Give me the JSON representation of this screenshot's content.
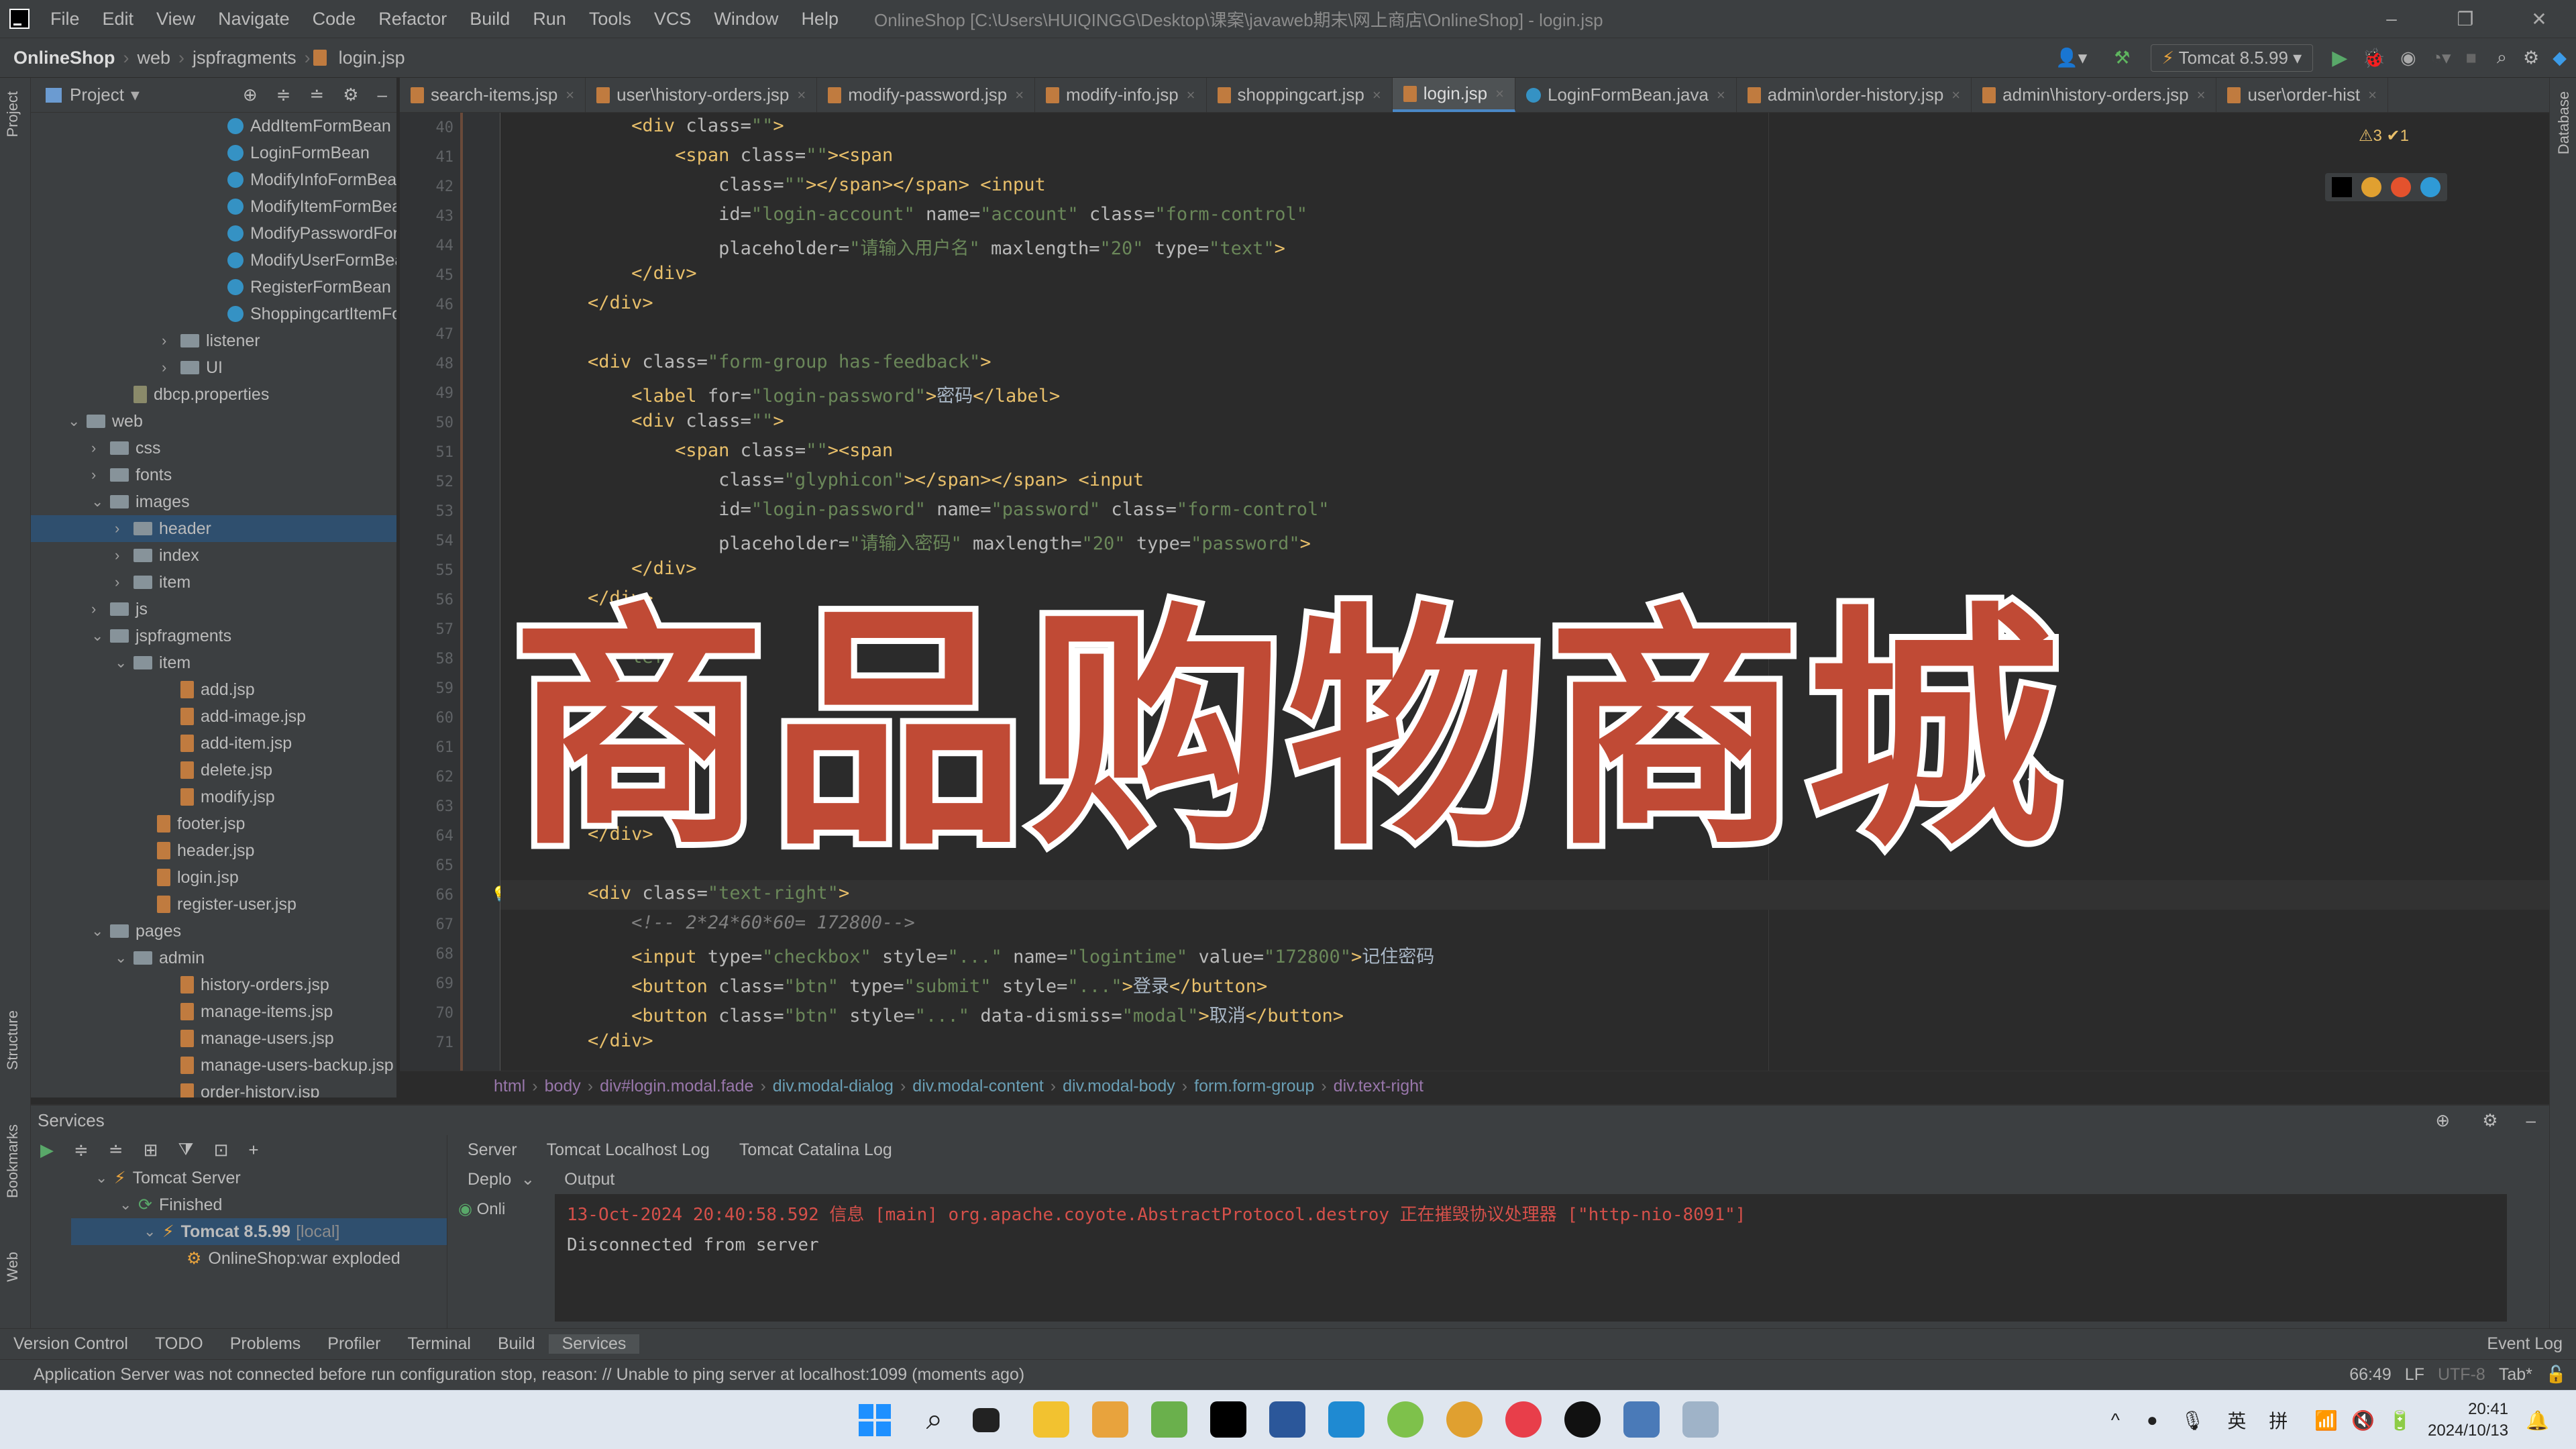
{
  "menubar": {
    "items": [
      "File",
      "Edit",
      "View",
      "Navigate",
      "Code",
      "Refactor",
      "Build",
      "Run",
      "Tools",
      "VCS",
      "Window",
      "Help"
    ],
    "title": "OnlineShop [C:\\Users\\HUIQINGG\\Desktop\\课案\\javaweb期末\\网上商店\\OnlineShop] - login.jsp"
  },
  "navbar": {
    "crumbs": [
      "OnlineShop",
      "web",
      "jspfragments",
      "login.jsp"
    ],
    "run_config": "Tomcat 8.5.99"
  },
  "project": {
    "title": "Project",
    "tree": [
      {
        "label": "AddItemFormBean",
        "icon": "class-icon",
        "depth": 7,
        "arrow": ""
      },
      {
        "label": "LoginFormBean",
        "icon": "class-icon",
        "depth": 7,
        "arrow": ""
      },
      {
        "label": "ModifyInfoFormBean",
        "icon": "class-icon",
        "depth": 7,
        "arrow": ""
      },
      {
        "label": "ModifyItemFormBean",
        "icon": "class-icon",
        "depth": 7,
        "arrow": ""
      },
      {
        "label": "ModifyPasswordFormBe",
        "icon": "class-icon",
        "depth": 7,
        "arrow": ""
      },
      {
        "label": "ModifyUserFormBean",
        "icon": "class-icon",
        "depth": 7,
        "arrow": ""
      },
      {
        "label": "RegisterFormBean",
        "icon": "class-icon",
        "depth": 7,
        "arrow": ""
      },
      {
        "label": "ShoppingcartItemFormB",
        "icon": "class-icon",
        "depth": 7,
        "arrow": ""
      },
      {
        "label": "listener",
        "icon": "folder-icon",
        "depth": 5,
        "arrow": "›"
      },
      {
        "label": "UI",
        "icon": "folder-icon",
        "depth": 5,
        "arrow": "›"
      },
      {
        "label": "dbcp.properties",
        "icon": "properties-icon",
        "depth": 3,
        "arrow": ""
      },
      {
        "label": "web",
        "icon": "folder-icon",
        "depth": 1,
        "arrow": "⌄"
      },
      {
        "label": "css",
        "icon": "folder-icon",
        "depth": 2,
        "arrow": "›"
      },
      {
        "label": "fonts",
        "icon": "folder-icon",
        "depth": 2,
        "arrow": "›"
      },
      {
        "label": "images",
        "icon": "folder-icon",
        "depth": 2,
        "arrow": "⌄"
      },
      {
        "label": "header",
        "icon": "folder-icon",
        "depth": 3,
        "arrow": "›",
        "selected": true
      },
      {
        "label": "index",
        "icon": "folder-icon",
        "depth": 3,
        "arrow": "›"
      },
      {
        "label": "item",
        "icon": "folder-icon",
        "depth": 3,
        "arrow": "›"
      },
      {
        "label": "js",
        "icon": "folder-icon",
        "depth": 2,
        "arrow": "›"
      },
      {
        "label": "jspfragments",
        "icon": "folder-icon",
        "depth": 2,
        "arrow": "⌄"
      },
      {
        "label": "item",
        "icon": "folder-icon",
        "depth": 3,
        "arrow": "⌄"
      },
      {
        "label": "add.jsp",
        "icon": "jsp-icon",
        "depth": 5,
        "arrow": ""
      },
      {
        "label": "add-image.jsp",
        "icon": "jsp-icon",
        "depth": 5,
        "arrow": ""
      },
      {
        "label": "add-item.jsp",
        "icon": "jsp-icon",
        "depth": 5,
        "arrow": ""
      },
      {
        "label": "delete.jsp",
        "icon": "jsp-icon",
        "depth": 5,
        "arrow": ""
      },
      {
        "label": "modify.jsp",
        "icon": "jsp-icon",
        "depth": 5,
        "arrow": ""
      },
      {
        "label": "footer.jsp",
        "icon": "jsp-icon",
        "depth": 4,
        "arrow": ""
      },
      {
        "label": "header.jsp",
        "icon": "jsp-icon",
        "depth": 4,
        "arrow": ""
      },
      {
        "label": "login.jsp",
        "icon": "jsp-icon",
        "depth": 4,
        "arrow": ""
      },
      {
        "label": "register-user.jsp",
        "icon": "jsp-icon",
        "depth": 4,
        "arrow": ""
      },
      {
        "label": "pages",
        "icon": "folder-icon",
        "depth": 2,
        "arrow": "⌄"
      },
      {
        "label": "admin",
        "icon": "folder-icon",
        "depth": 3,
        "arrow": "⌄"
      },
      {
        "label": "history-orders.jsp",
        "icon": "jsp-icon",
        "depth": 5,
        "arrow": ""
      },
      {
        "label": "manage-items.jsp",
        "icon": "jsp-icon",
        "depth": 5,
        "arrow": ""
      },
      {
        "label": "manage-users.jsp",
        "icon": "jsp-icon",
        "depth": 5,
        "arrow": ""
      },
      {
        "label": "manage-users-backup.jsp",
        "icon": "jsp-icon",
        "depth": 5,
        "arrow": ""
      },
      {
        "label": "order-history.jsp",
        "icon": "jsp-icon",
        "depth": 5,
        "arrow": ""
      }
    ]
  },
  "tabs": [
    {
      "label": "search-items.jsp",
      "kind": "jsp"
    },
    {
      "label": "user\\history-orders.jsp",
      "kind": "jsp"
    },
    {
      "label": "modify-password.jsp",
      "kind": "jsp"
    },
    {
      "label": "modify-info.jsp",
      "kind": "jsp"
    },
    {
      "label": "shoppingcart.jsp",
      "kind": "jsp"
    },
    {
      "label": "login.jsp",
      "kind": "jsp",
      "active": true
    },
    {
      "label": "LoginFormBean.java",
      "kind": "java"
    },
    {
      "label": "admin\\order-history.jsp",
      "kind": "jsp"
    },
    {
      "label": "admin\\history-orders.jsp",
      "kind": "jsp"
    },
    {
      "label": "user\\order-hist",
      "kind": "jsp"
    }
  ],
  "editor": {
    "inspections": "⚠3 ✔1",
    "lines": [
      {
        "n": "40",
        "html": "            <span class='t'>&lt;div </span><span class='a'>class=</span><span class='v'>\"\"</span><span class='t'>&gt;</span>"
      },
      {
        "n": "41",
        "html": "                <span class='t'>&lt;span </span><span class='a'>class=</span><span class='v'>\"\"</span><span class='t'>&gt;&lt;span</span>"
      },
      {
        "n": "42",
        "html": "                    <span class='a'>class=</span><span class='v'>\"\"</span><span class='t'>&gt;&lt;/span&gt;&lt;/span&gt; &lt;input</span>"
      },
      {
        "n": "43",
        "html": "                    <span class='a'>id=</span><span class='v'>\"login-account\"</span> <span class='a'>name=</span><span class='v'>\"account\"</span> <span class='a'>class=</span><span class='v'>\"form-control\"</span>"
      },
      {
        "n": "44",
        "html": "                    <span class='a'>placeholder=</span><span class='v'>\"请输入用户名\"</span> <span class='a'>maxlength=</span><span class='v'>\"20\"</span> <span class='a'>type=</span><span class='v'>\"text\"</span><span class='t'>&gt;</span>"
      },
      {
        "n": "45",
        "html": "            <span class='t'>&lt;/div&gt;</span>"
      },
      {
        "n": "46",
        "html": "        <span class='t'>&lt;/div&gt;</span>"
      },
      {
        "n": "47",
        "html": ""
      },
      {
        "n": "48",
        "html": "        <span class='t'>&lt;div </span><span class='a'>class=</span><span class='v'>\"form-group has-feedback\"</span><span class='t'>&gt;</span>"
      },
      {
        "n": "49",
        "html": "            <span class='t'>&lt;label </span><span class='a'>for=</span><span class='v'>\"login-password\"</span><span class='t'>&gt;</span><span class='tx'>密码</span><span class='t'>&lt;/label&gt;</span>"
      },
      {
        "n": "50",
        "html": "            <span class='t'>&lt;div </span><span class='a'>class=</span><span class='v'>\"\"</span><span class='t'>&gt;</span>"
      },
      {
        "n": "51",
        "html": "                <span class='t'>&lt;span </span><span class='a'>class=</span><span class='v'>\"\"</span><span class='t'>&gt;&lt;span</span>"
      },
      {
        "n": "52",
        "html": "                    <span class='a'>class=</span><span class='v'>\"glyphicon\"</span><span class='t'>&gt;&lt;/span&gt;&lt;/span&gt; &lt;input</span>"
      },
      {
        "n": "53",
        "html": "                    <span class='a'>id=</span><span class='v'>\"login-password\"</span> <span class='a'>name=</span><span class='v'>\"password\"</span> <span class='a'>class=</span><span class='v'>\"form-control\"</span>"
      },
      {
        "n": "54",
        "html": "                    <span class='a'>placeholder=</span><span class='v'>\"请输入密码\"</span> <span class='a'>maxlength=</span><span class='v'>\"20\"</span> <span class='a'>type=</span><span class='v'>\"password\"</span><span class='t'>&gt;</span>"
      },
      {
        "n": "55",
        "html": "            <span class='t'>&lt;/div&gt;</span>"
      },
      {
        "n": "56",
        "html": "        <span class='t'>&lt;/div&gt;</span>"
      },
      {
        "n": "57",
        "html": ""
      },
      {
        "n": "58",
        "html": "            <span class='v'>lef</span>"
      },
      {
        "n": "59",
        "html": "            <span class='a'>l c</span>               <span class='v'>e\"&gt;</span>"
      },
      {
        "n": "60",
        "html": ""
      },
      {
        "n": "61",
        "html": ""
      },
      {
        "n": "62",
        "html": ""
      },
      {
        "n": "63",
        "html": ""
      },
      {
        "n": "64",
        "html": "        <span class='t'>&lt;/div&gt;</span>"
      },
      {
        "n": "65",
        "html": ""
      },
      {
        "n": "66",
        "html": "        <span class='t'>&lt;div </span><span class='a'>class=</span><span class='v'>\"text-right\"</span><span class='t'>&gt;</span>"
      },
      {
        "n": "67",
        "html": "            <span class='c'>&lt;!-- 2*24*60*60= 172800--&gt;</span>"
      },
      {
        "n": "68",
        "html": "            <span class='t'>&lt;input </span><span class='a'>type=</span><span class='v'>\"checkbox\"</span> <span class='a'>style=</span><span class='v'>\"...\"</span> <span class='a'>name=</span><span class='v'>\"logintime\"</span> <span class='a'>value=</span><span class='v'>\"172800\"</span><span class='t'>&gt;</span><span class='tx'>记住密码</span>"
      },
      {
        "n": "69",
        "html": "            <span class='t'>&lt;button </span><span class='a'>class=</span><span class='v'>\"btn\"</span> <span class='a'>type=</span><span class='v'>\"submit\"</span> <span class='a'>style=</span><span class='v'>\"...\"</span><span class='t'>&gt;</span><span class='tx'>登录</span><span class='t'>&lt;/button&gt;</span>"
      },
      {
        "n": "70",
        "html": "            <span class='t'>&lt;button </span><span class='a'>class=</span><span class='v'>\"btn\"</span> <span class='a'>style=</span><span class='v'>\"...\"</span> <span class='a'>data-dismiss=</span><span class='v'>\"modal\"</span><span class='t'>&gt;</span><span class='tx'>取消</span><span class='t'>&lt;/button&gt;</span>"
      },
      {
        "n": "71",
        "html": "        <span class='t'>&lt;/div&gt;</span>"
      }
    ],
    "breadcrumbs": [
      "html",
      "body",
      "div#login.modal.fade",
      "div.modal-dialog",
      "div.modal-content",
      "div.modal-body",
      "form.form-group",
      "div.text-right"
    ]
  },
  "overlay_title": "商品购物商城",
  "services": {
    "title": "Services",
    "tree": [
      {
        "label": "Tomcat Server",
        "depth": 1
      },
      {
        "label": "Finished",
        "depth": 2
      },
      {
        "label": "Tomcat 8.5.99",
        "suffix": "[local]",
        "depth": 3,
        "selected": true
      },
      {
        "label": "OnlineShop:war exploded",
        "depth": 4
      }
    ],
    "tabs": [
      "Server",
      "Tomcat Localhost Log",
      "Tomcat Catalina Log"
    ],
    "deploy_label": "Deplo",
    "output_label": "Output",
    "online_label": "Onli",
    "console_line1": "13-Oct-2024 20:40:58.592 信息 [main] org.apache.coyote.AbstractProtocol.destroy 正在摧毁协议处理器 [\"http-nio-8091\"]",
    "console_line2": "Disconnected from server"
  },
  "bottom_tools": [
    "Version Control",
    "TODO",
    "Problems",
    "Profiler",
    "Terminal",
    "Build",
    "Services"
  ],
  "event_log": "Event Log",
  "status": {
    "message": "Application Server was not connected before run configuration stop, reason: // Unable to ping server at localhost:1099 (moments ago)",
    "position": "66:49",
    "line_sep": "LF",
    "encoding": "UTF-8",
    "indent": "Tab*"
  },
  "taskbar": {
    "ime1": "英",
    "ime2": "拼",
    "time": "20:41",
    "date": "2024/10/13"
  },
  "side_labels": {
    "project": "Project",
    "structure": "Structure",
    "bookmarks": "Bookmarks",
    "web": "Web",
    "database": "Database"
  }
}
